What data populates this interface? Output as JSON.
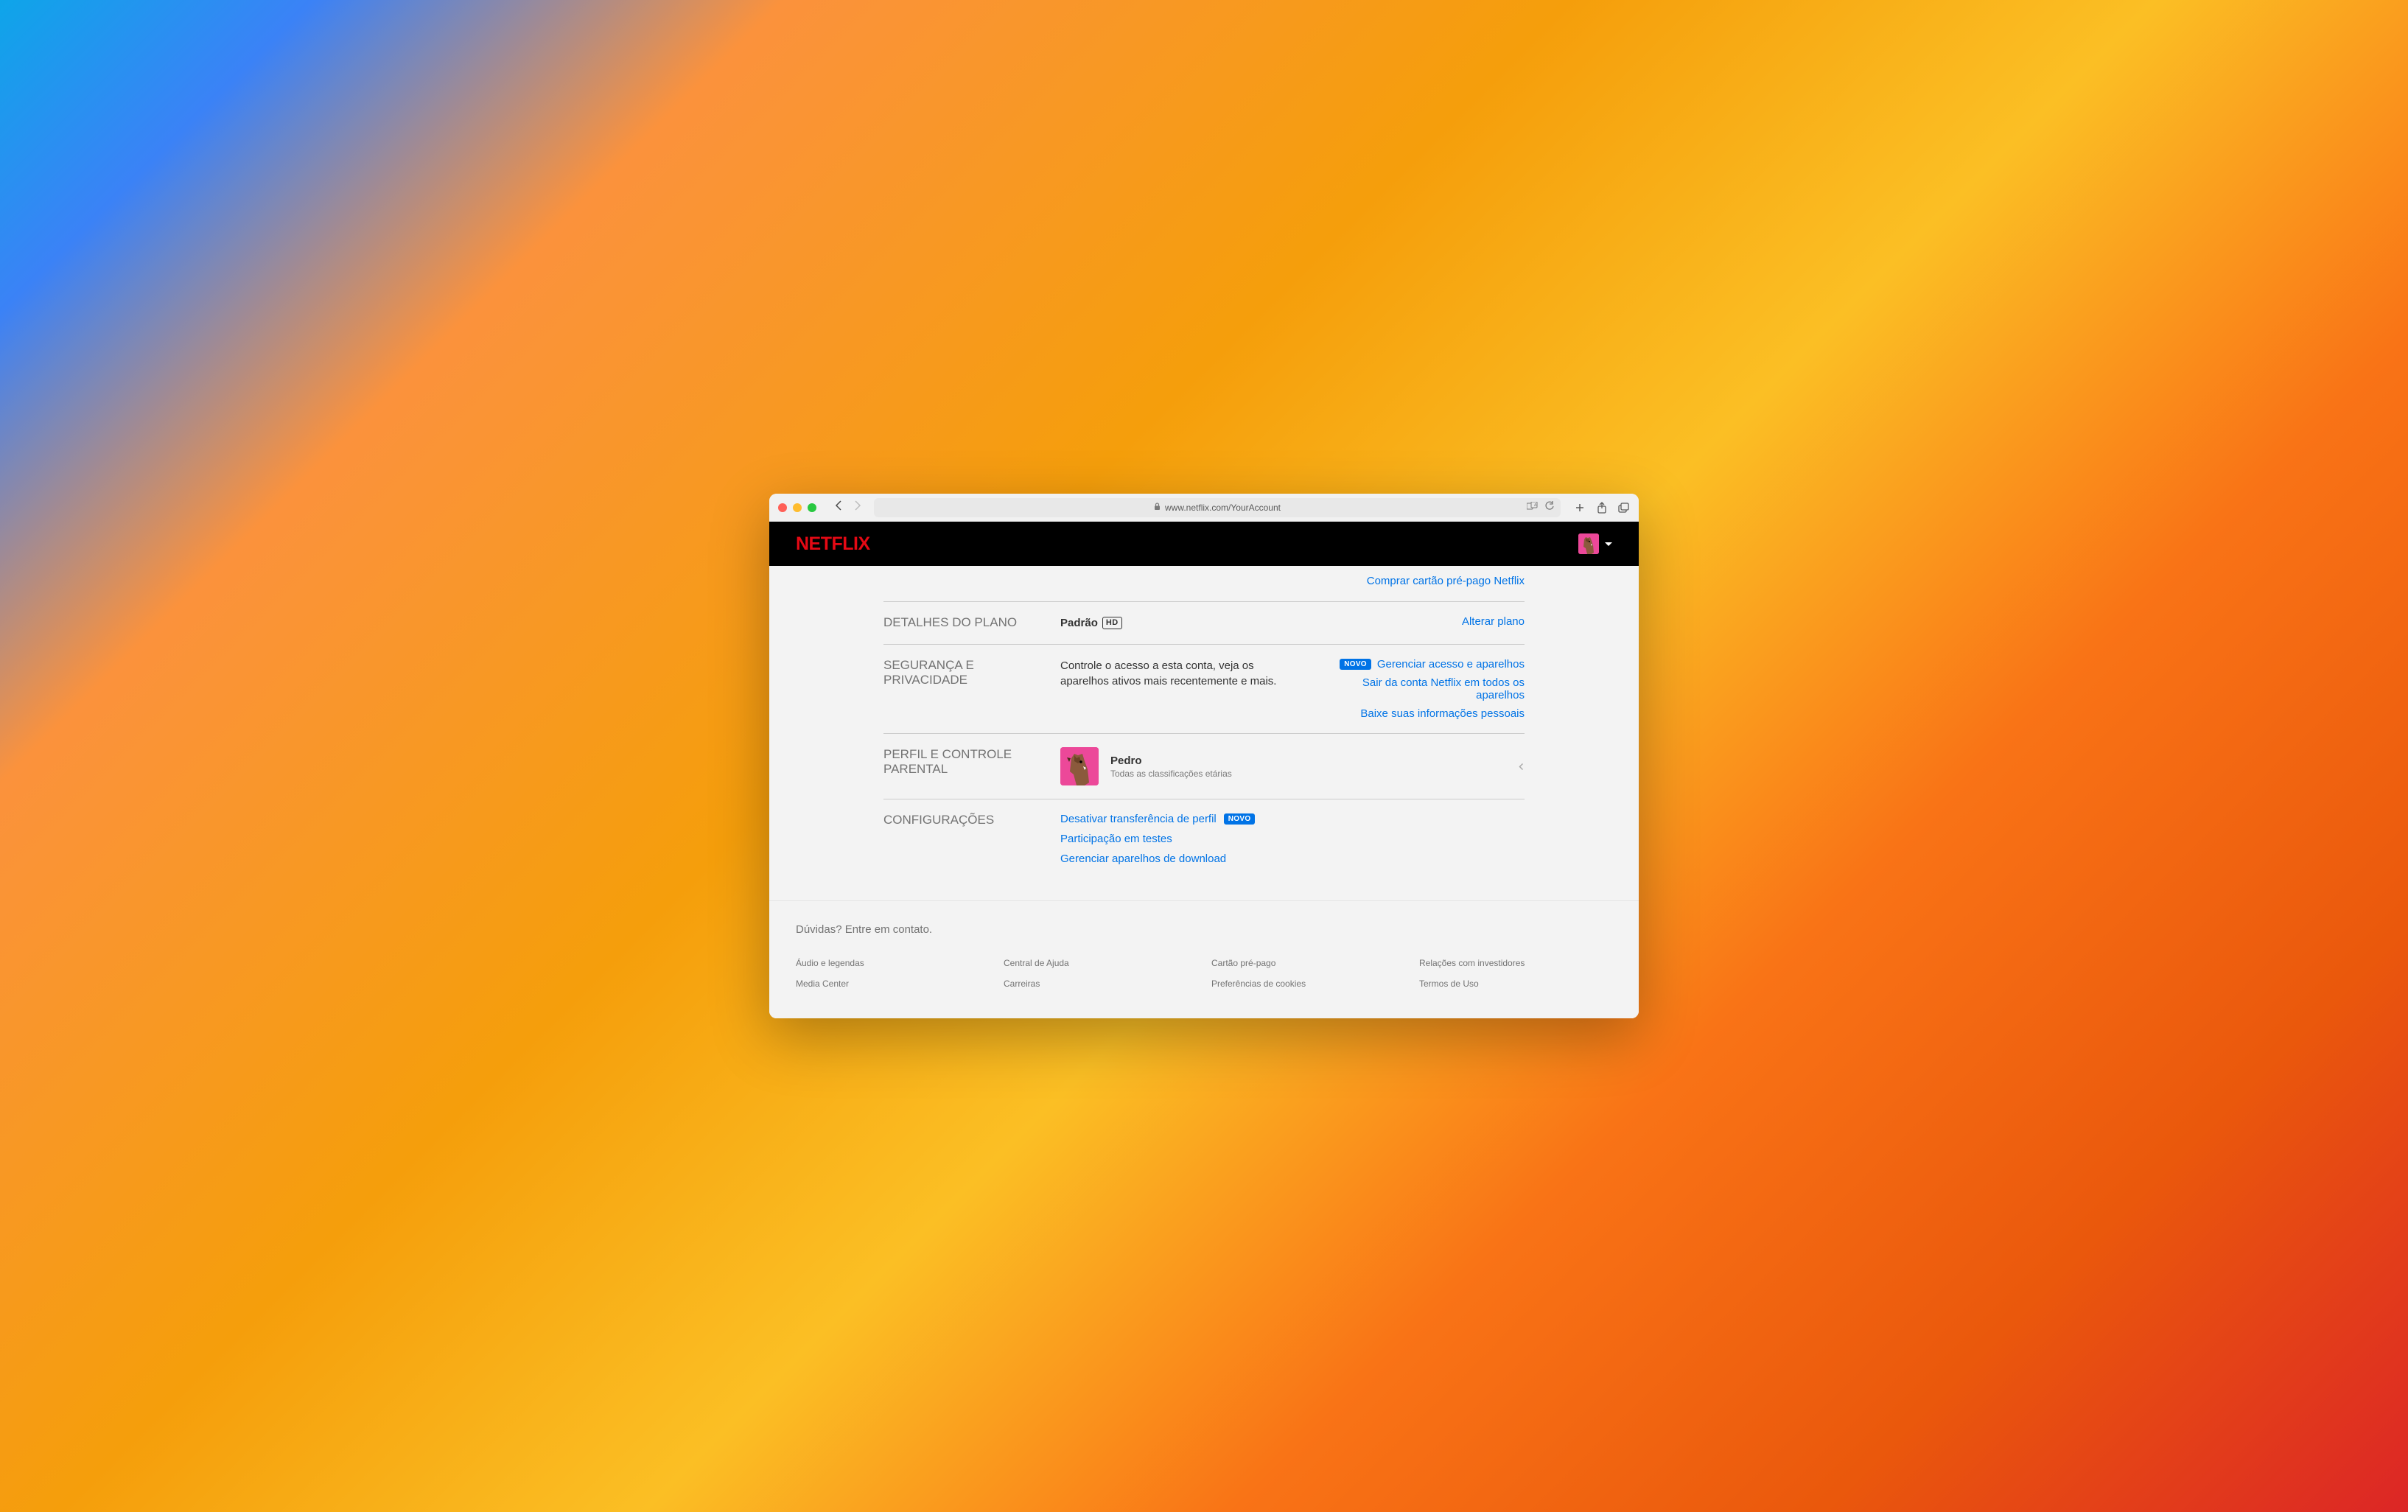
{
  "browser": {
    "url": "www.netflix.com/YourAccount"
  },
  "header": {
    "logo": "NETFLIX"
  },
  "topLink": "Comprar cartão pré-pago Netflix",
  "sections": {
    "plan": {
      "label": "DETALHES DO PLANO",
      "planName": "Padrão",
      "badge": "HD",
      "changeLink": "Alterar plano"
    },
    "security": {
      "label": "SEGURANÇA E PRIVACIDADE",
      "desc": "Controle o acesso a esta conta, veja os aparelhos ativos mais recentemente e mais.",
      "badgeNovo": "NOVO",
      "links": {
        "manageAccess": "Gerenciar acesso e aparelhos",
        "signOutAll": "Sair da conta Netflix em todos os aparelhos",
        "download": "Baixe suas informações pessoais"
      }
    },
    "profile": {
      "label": "PERFIL E CONTROLE PARENTAL",
      "name": "Pedro",
      "subtitle": "Todas as classificações etárias"
    },
    "config": {
      "label": "CONFIGURAÇÕES",
      "badgeNovo": "NOVO",
      "links": {
        "disableTransfer": "Desativar transferência de perfil",
        "testParticipation": "Participação em testes",
        "manageDownloads": "Gerenciar aparelhos de download"
      }
    }
  },
  "footer": {
    "intro": "Dúvidas? Entre em contato.",
    "links": [
      "Áudio e legendas",
      "Central de Ajuda",
      "Cartão pré-pago",
      "Relações com investidores",
      "Media Center",
      "Carreiras",
      "Preferências de cookies",
      "Termos de Uso"
    ]
  }
}
